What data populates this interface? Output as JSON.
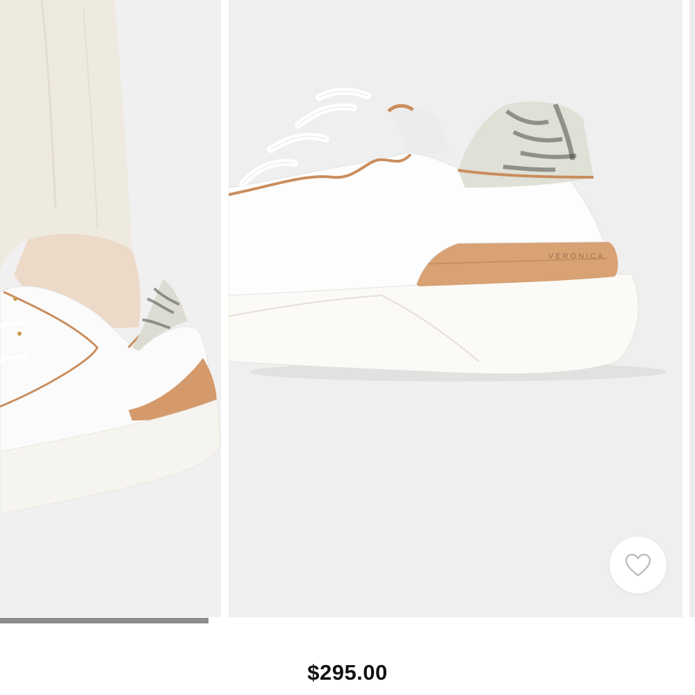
{
  "gallery": {
    "slides": [
      {
        "label": "product-photo-worn-heel-view"
      },
      {
        "label": "product-photo-back-view",
        "brand_text": "VERONICA"
      },
      {
        "label": "product-photo-next-peek"
      }
    ],
    "favorite": {
      "icon": "heart-outline-icon"
    },
    "progress": {
      "fraction": 0.3,
      "color": "#8c8c8c"
    }
  },
  "product": {
    "price": "$295.00"
  },
  "colors": {
    "background": "#f0eff0",
    "tan_accent": "#c98d5d",
    "price_text": "#111111"
  }
}
